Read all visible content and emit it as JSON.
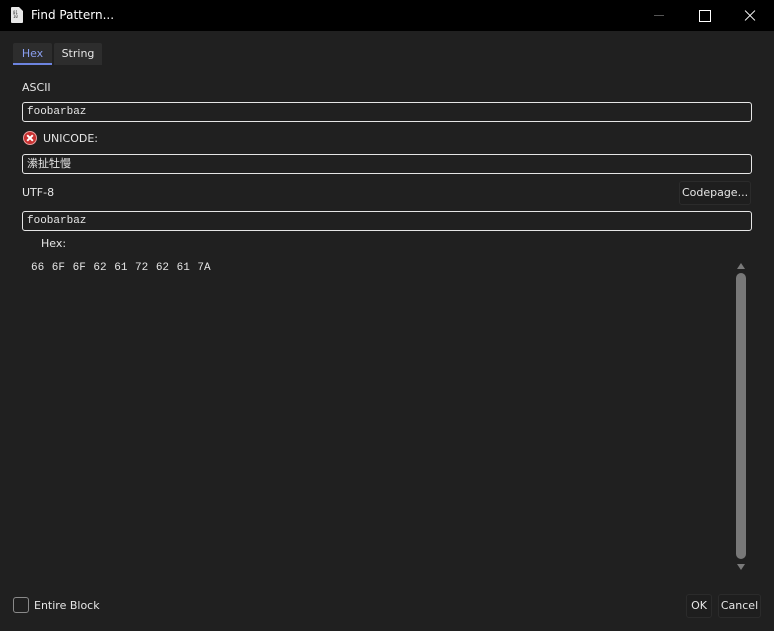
{
  "window": {
    "title": "Find Pattern...",
    "icon": "binary-file-icon",
    "icon_text": "01 10"
  },
  "tabs": [
    {
      "label": "Hex",
      "active": true
    },
    {
      "label": "String",
      "active": false
    }
  ],
  "accent_color": "#6d84e0",
  "fields": {
    "ascii": {
      "label": "ASCII",
      "value": "foobarbaz"
    },
    "unicode": {
      "label": "UNICODE:",
      "value": "潫扯牡慢",
      "status": "error-icon"
    },
    "utf8": {
      "label": "UTF-8",
      "value": "foobarbaz"
    }
  },
  "codepage_button": "Codepage...",
  "hex": {
    "label": "Hex:",
    "value": "66 6F 6F 62 61 72 62 61 7A"
  },
  "entire_block": {
    "label": "Entire Block",
    "checked": false
  },
  "buttons": {
    "ok": "OK",
    "cancel": "Cancel"
  }
}
